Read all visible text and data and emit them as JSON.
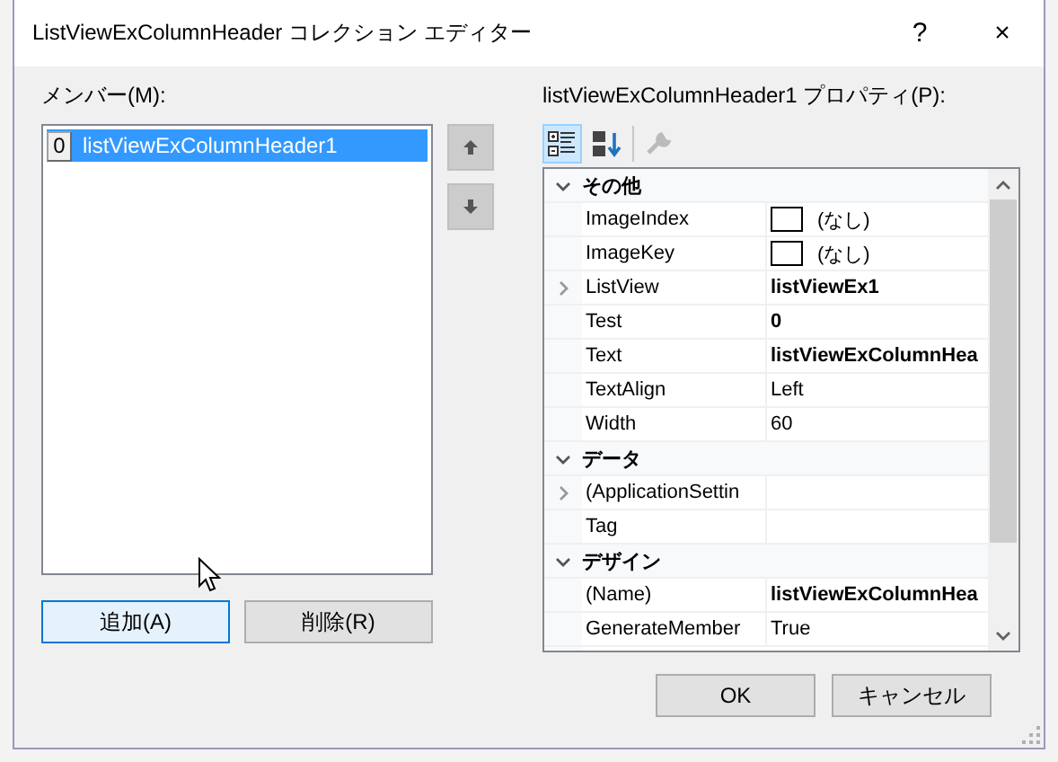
{
  "window": {
    "title": "ListViewExColumnHeader コレクション エディター",
    "help": "?",
    "close": "×"
  },
  "members": {
    "label": "メンバー(M):",
    "items": [
      {
        "index": "0",
        "name": "listViewExColumnHeader1",
        "selected": true
      }
    ]
  },
  "move_buttons": [
    {
      "kind": "up"
    },
    {
      "kind": "down"
    }
  ],
  "member_buttons": [
    {
      "label": "追加(A)",
      "focused": true
    },
    {
      "label": "削除(R)",
      "focused": false
    }
  ],
  "properties": {
    "label": "listViewExColumnHeader1 プロパティ(P):",
    "toolbar": [
      {
        "kind": "categorized",
        "selected": true,
        "disabled": false
      },
      {
        "kind": "alphabetical",
        "selected": false,
        "disabled": false
      },
      {
        "kind": "pages",
        "selected": false,
        "disabled": true
      }
    ],
    "categories": [
      {
        "name": "その他",
        "expanded": true,
        "children": [
          {
            "name": "ImageIndex",
            "value": "(なし)",
            "kind": "image",
            "expandable": false,
            "bold": false
          },
          {
            "name": "ImageKey",
            "value": "(なし)",
            "kind": "image",
            "expandable": false,
            "bold": false
          },
          {
            "name": "ListView",
            "value": "listViewEx1",
            "kind": "text",
            "expandable": true,
            "bold": true
          },
          {
            "name": "Test",
            "value": "0",
            "kind": "text",
            "expandable": false,
            "bold": true
          },
          {
            "name": "Text",
            "value": "listViewExColumnHea",
            "kind": "text",
            "expandable": false,
            "bold": true
          },
          {
            "name": "TextAlign",
            "value": "Left",
            "kind": "text",
            "expandable": false,
            "bold": false
          },
          {
            "name": "Width",
            "value": "60",
            "kind": "text",
            "expandable": false,
            "bold": false
          }
        ]
      },
      {
        "name": "データ",
        "expanded": true,
        "children": [
          {
            "name": "(ApplicationSettin",
            "kind": "text",
            "expandable": true,
            "bold": false
          },
          {
            "name": "Tag",
            "kind": "text",
            "expandable": false,
            "bold": false
          }
        ]
      },
      {
        "name": "デザイン",
        "expanded": true,
        "children": [
          {
            "name": "(Name)",
            "value": "listViewExColumnHea",
            "kind": "text",
            "expandable": false,
            "bold": true
          },
          {
            "name": "GenerateMember",
            "value": "True",
            "kind": "text",
            "expandable": false,
            "bold": false
          }
        ]
      }
    ]
  },
  "dialog_buttons": [
    {
      "label": "OK"
    },
    {
      "label": "キャンセル"
    }
  ]
}
